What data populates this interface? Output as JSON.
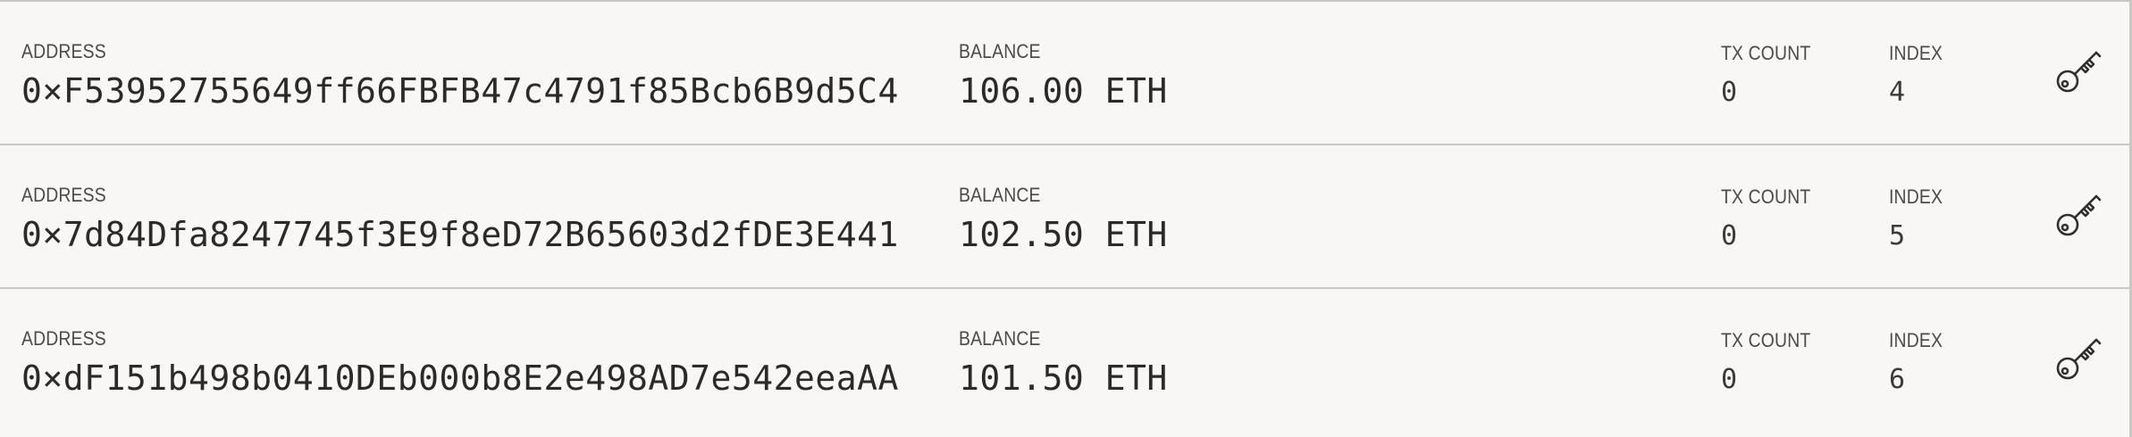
{
  "accounts": [
    {
      "address_label": "ADDRESS",
      "address": "0×F53952755649ff66FBFB47c4791f85Bcb6B9d5C4",
      "balance_label": "BALANCE",
      "balance": "106.00 ETH",
      "tx_count_label": "TX COUNT",
      "tx_count": "0",
      "index_label": "INDEX",
      "index": "4",
      "action_icon": "key-icon"
    },
    {
      "address_label": "ADDRESS",
      "address": "0×7d84Dfa8247745f3E9f8eD72B65603d2fDE3E441",
      "balance_label": "BALANCE",
      "balance": "102.50 ETH",
      "tx_count_label": "TX COUNT",
      "tx_count": "0",
      "index_label": "INDEX",
      "index": "5",
      "action_icon": "key-icon"
    },
    {
      "address_label": "ADDRESS",
      "address": "0×dF151b498b0410DEb000b8E2e498AD7e542eeaAA",
      "balance_label": "BALANCE",
      "balance": "101.50 ETH",
      "tx_count_label": "TX COUNT",
      "tx_count": "0",
      "index_label": "INDEX",
      "index": "6",
      "action_icon": "key-icon"
    }
  ]
}
